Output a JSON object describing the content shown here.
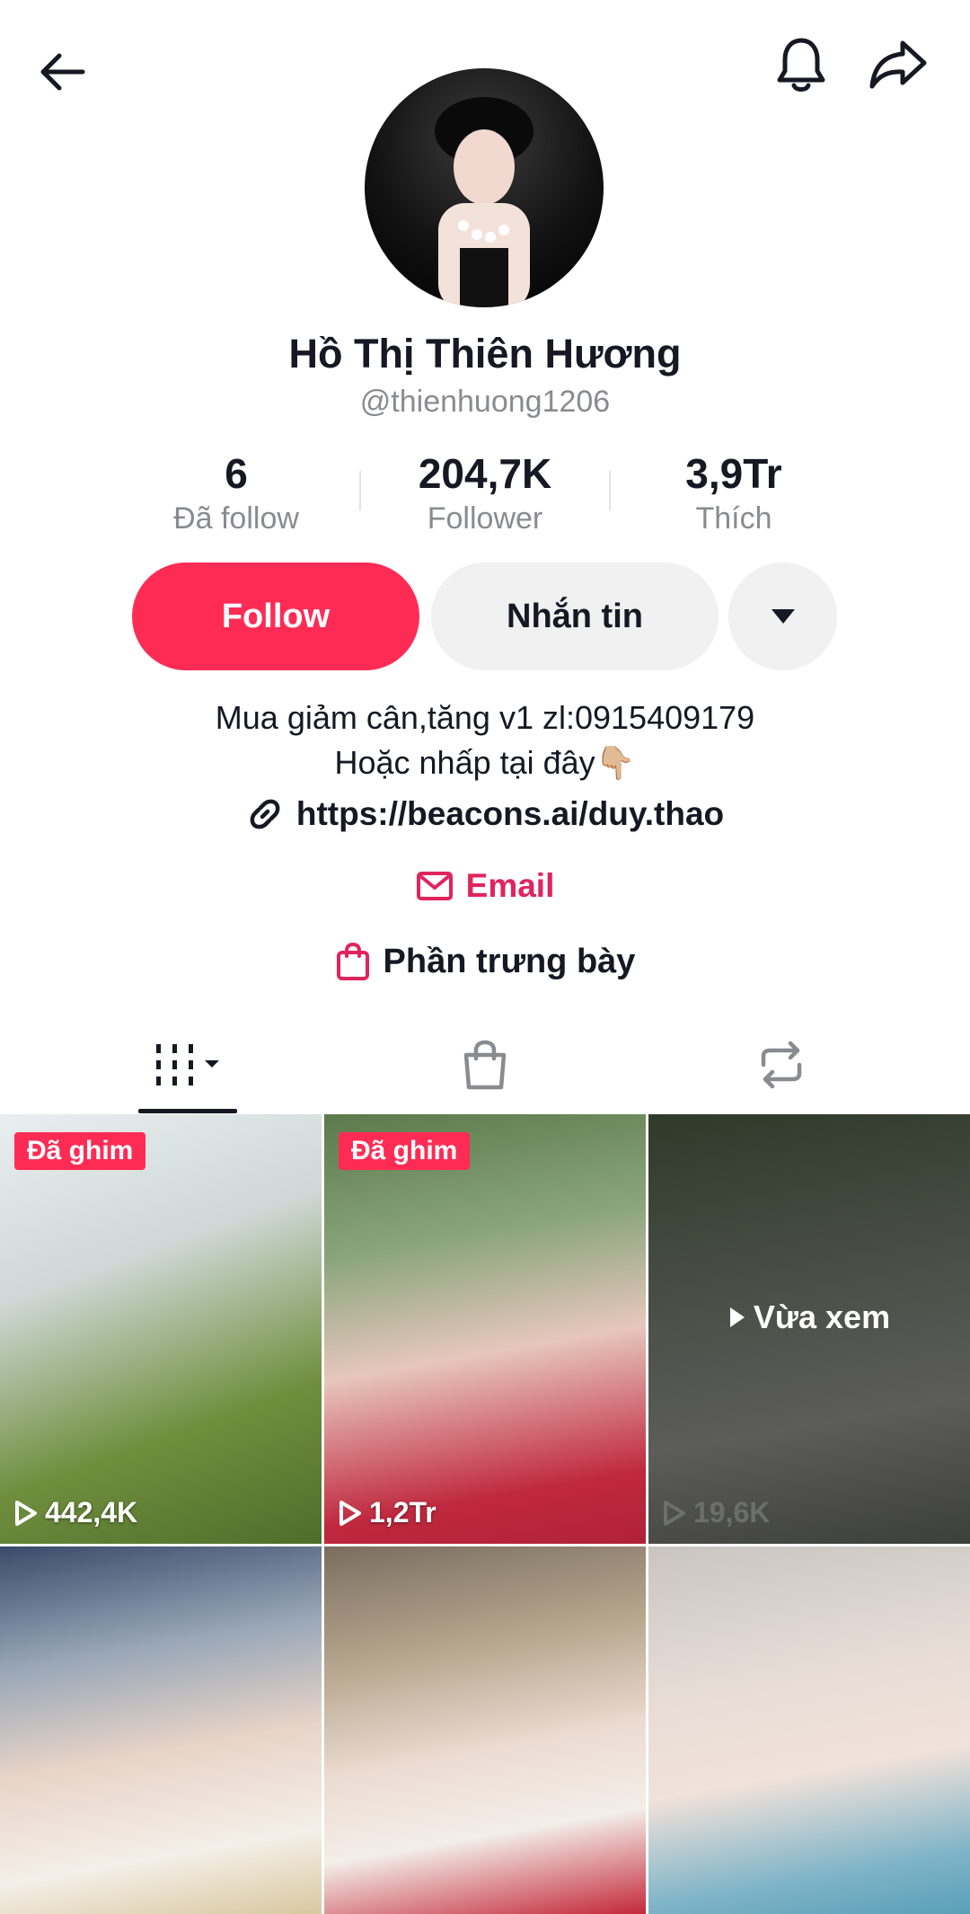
{
  "header": {
    "back_icon": "arrow-left-icon",
    "bell_icon": "bell-icon",
    "share_icon": "share-icon"
  },
  "profile": {
    "name": "Hồ Thị Thiên Hương",
    "handle": "@thienhuong1206"
  },
  "stats": [
    {
      "value": "6",
      "label": "Đã follow"
    },
    {
      "value": "204,7K",
      "label": "Follower"
    },
    {
      "value": "3,9Tr",
      "label": "Thích"
    }
  ],
  "actions": {
    "follow_label": "Follow",
    "message_label": "Nhắn tin",
    "more_icon": "caret-down-icon"
  },
  "bio": {
    "line1": "Mua giảm cân,tăng v1 zl:0915409179",
    "line2": "Hoặc nhấp tại đây👇🏼",
    "link": "https://beacons.ai/duy.thao",
    "email_label": "Email",
    "showcase_label": "Phần trưng bày"
  },
  "tabs": [
    {
      "icon": "videos-grid-icon",
      "active": true
    },
    {
      "icon": "shopping-bag-icon",
      "active": false
    },
    {
      "icon": "repost-icon",
      "active": false
    }
  ],
  "videos": [
    {
      "pinned_label": "Đã ghim",
      "views": "442,4K"
    },
    {
      "pinned_label": "Đã ghim",
      "views": "1,2Tr"
    },
    {
      "watched_label": "Vừa xem",
      "views": "19,6K"
    },
    {},
    {},
    {}
  ],
  "colors": {
    "accent": "#fe2c55",
    "email": "#e0245e",
    "muted": "#8a8b91",
    "button_bg": "#f1f1f2"
  }
}
